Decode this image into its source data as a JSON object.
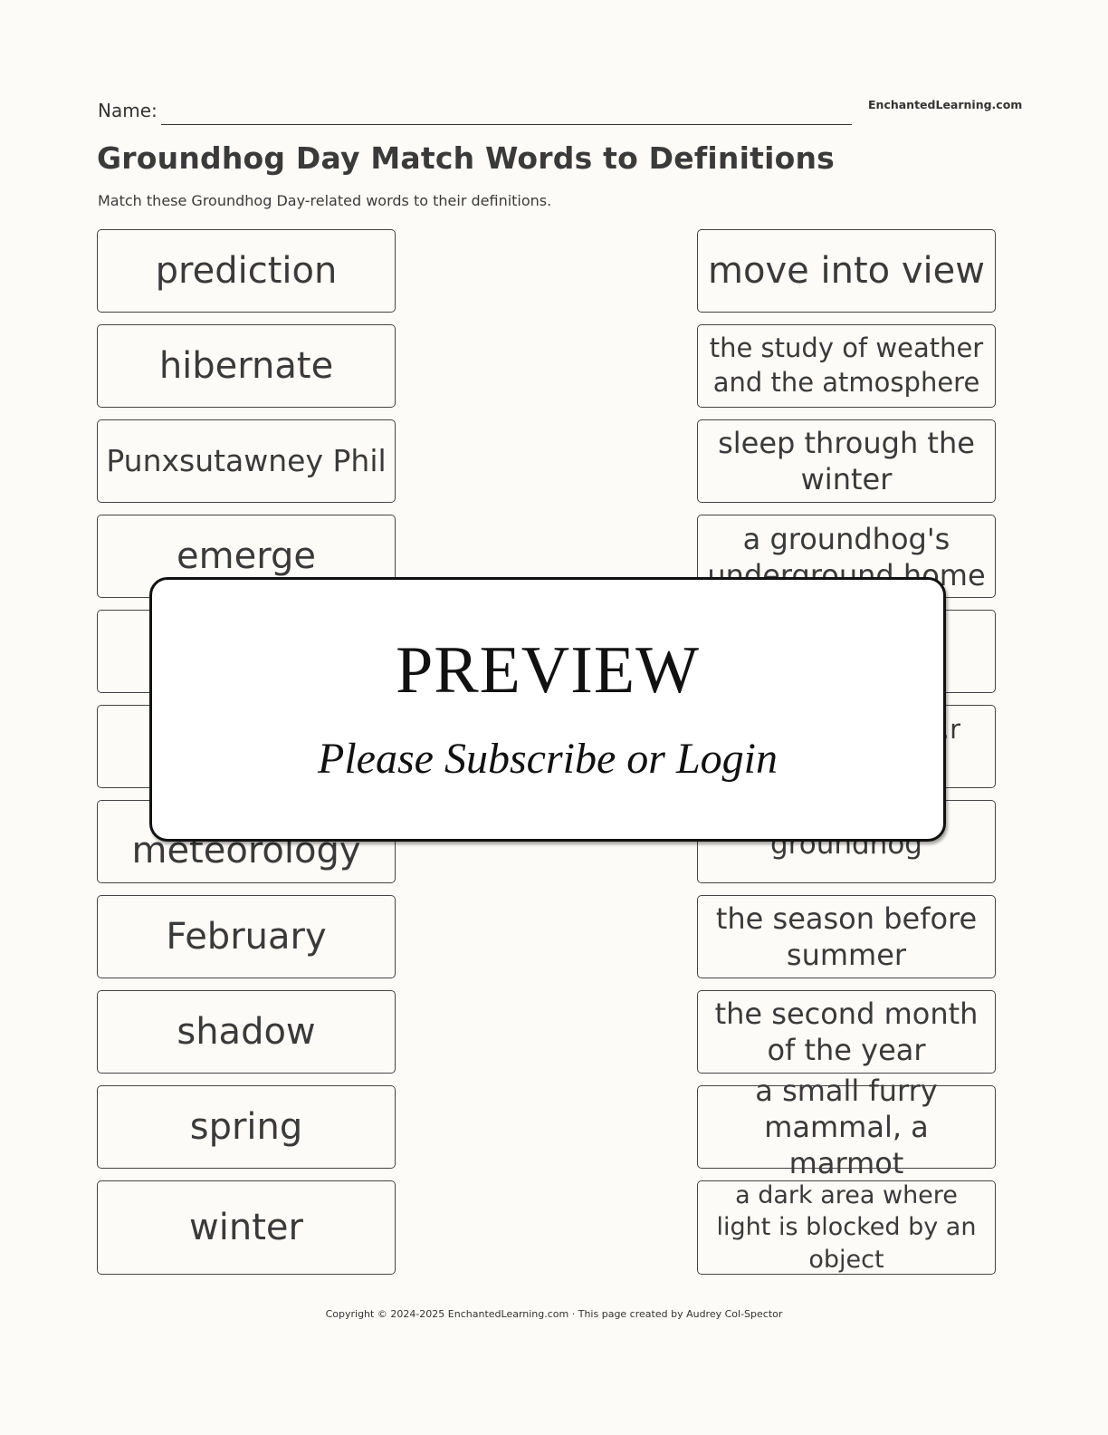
{
  "header": {
    "name_label": "Name:",
    "site_brand": "EnchantedLearning.com"
  },
  "worksheet": {
    "title": "Groundhog Day Match Words to Definitions",
    "instructions": "Match these Groundhog Day-related words to their definitions."
  },
  "words": [
    {
      "text": "prediction"
    },
    {
      "text": "hibernate"
    },
    {
      "text": "Punxsutawney Phil"
    },
    {
      "text": "emerge"
    },
    {
      "text": ""
    },
    {
      "text": ""
    },
    {
      "text": "meteorology"
    },
    {
      "text": "February"
    },
    {
      "text": "shadow"
    },
    {
      "text": "spring"
    },
    {
      "text": "winter"
    }
  ],
  "definitions": [
    {
      "text": "move into view"
    },
    {
      "text": "the study of weather and the atmosphere"
    },
    {
      "text": "sleep through the winter"
    },
    {
      "text": "a groundhog's underground home"
    },
    {
      "text": ""
    },
    {
      "text": "…r"
    },
    {
      "text": "a famous groundhog"
    },
    {
      "text": "the season before summer"
    },
    {
      "text": "the second month of the year"
    },
    {
      "text": "a small furry mammal, a marmot"
    },
    {
      "text": "a dark area where light is blocked by an object"
    }
  ],
  "preview_overlay": {
    "title": "PREVIEW",
    "message": "Please Subscribe or Login"
  },
  "footer": {
    "copyright": "Copyright © 2024-2025 EnchantedLearning.com · This page created by Audrey Col-Spector"
  }
}
